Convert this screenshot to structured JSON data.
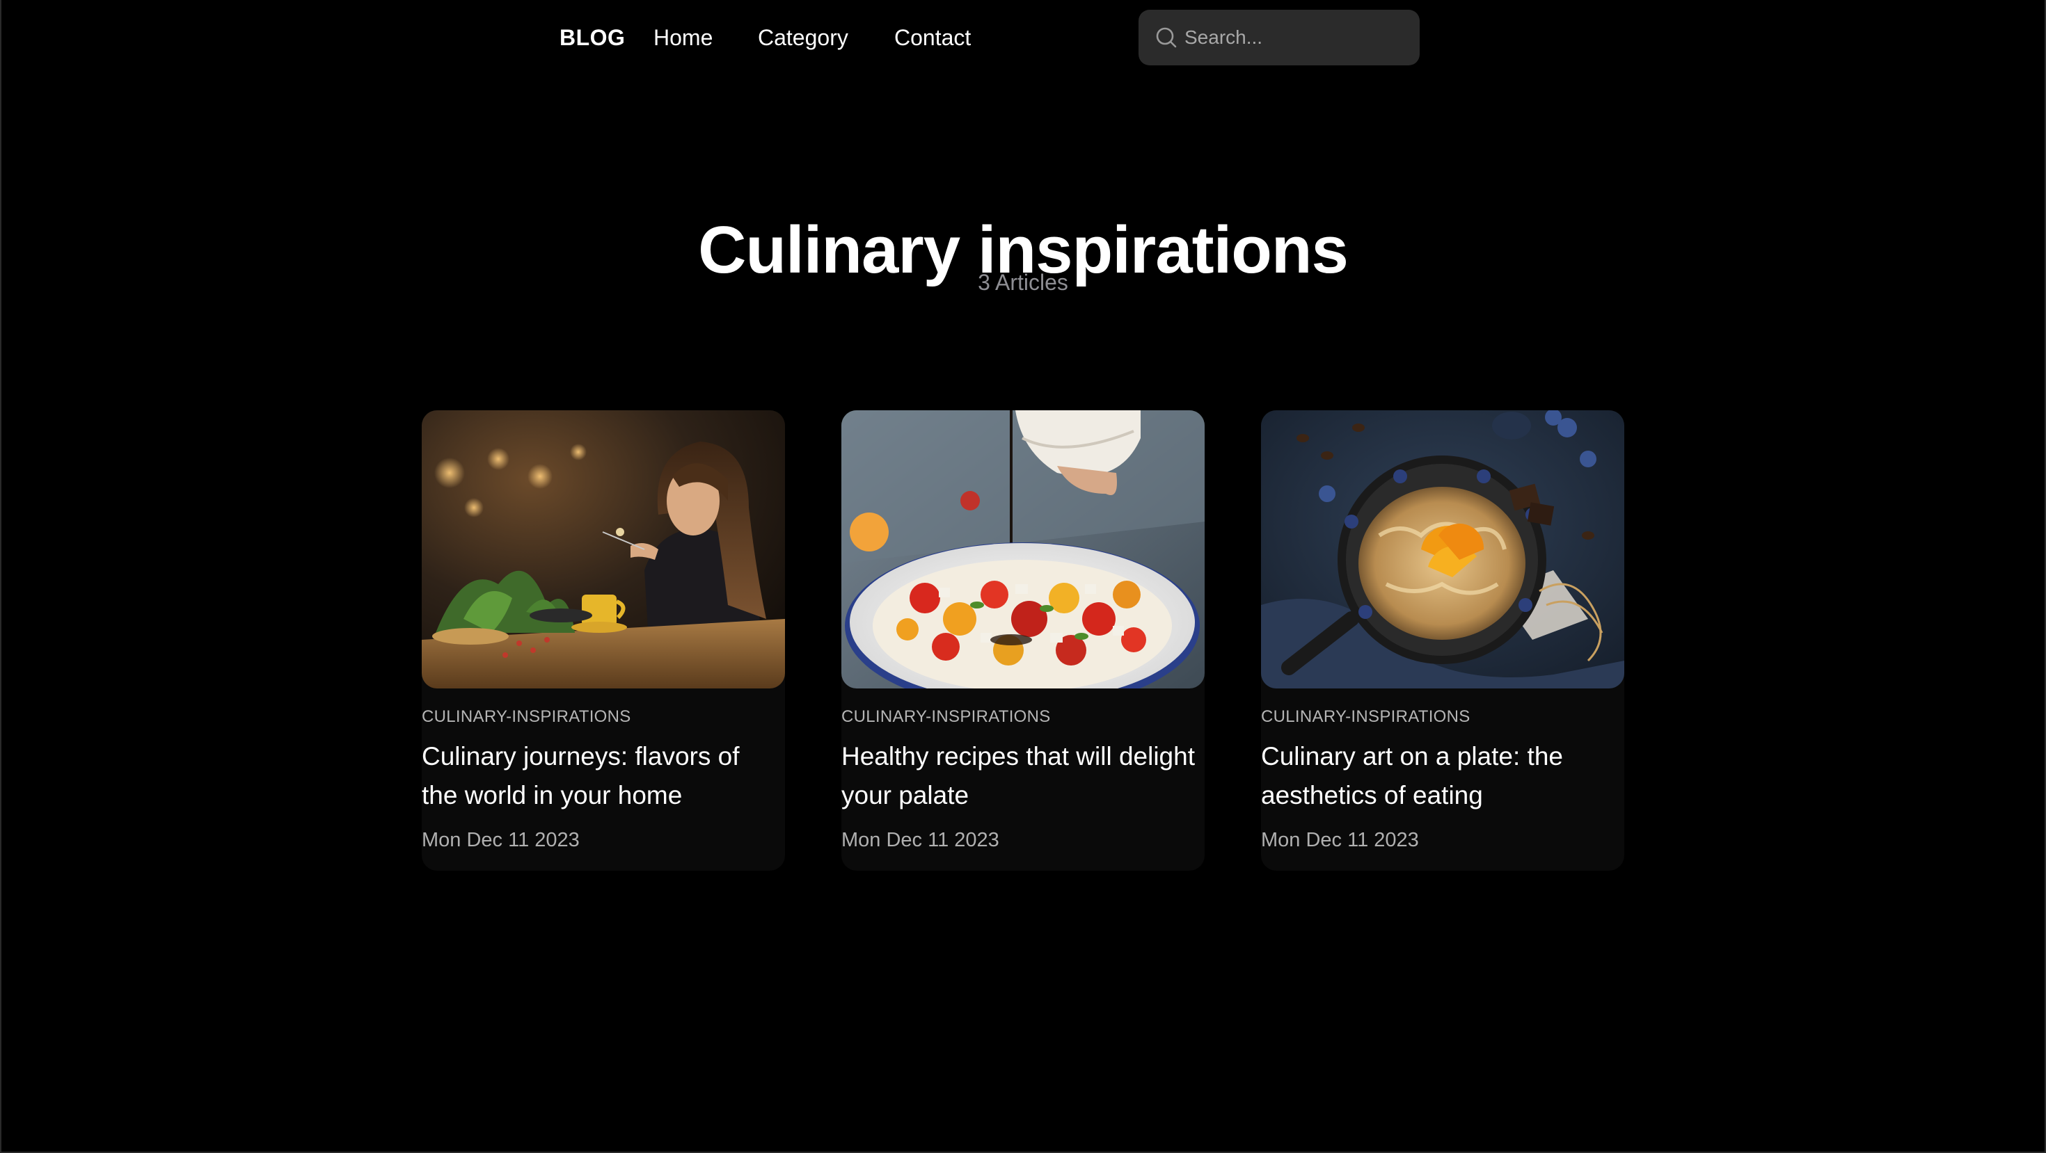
{
  "nav": {
    "brand": "BLOG",
    "links": [
      {
        "label": "Home"
      },
      {
        "label": "Category"
      },
      {
        "label": "Contact"
      }
    ],
    "search": {
      "placeholder": "Search...",
      "icon": "search-icon"
    }
  },
  "hero": {
    "title": "Culinary inspirations",
    "count": "3 Articles"
  },
  "articles": [
    {
      "category": "CULINARY-INSPIRATIONS",
      "title": "Culinary journeys: flavors of the world in your home",
      "date": "Mon Dec 11 2023",
      "image": "woman-eating-in-cafe-photo"
    },
    {
      "category": "CULINARY-INSPIRATIONS",
      "title": "Healthy recipes that will delight your palate",
      "date": "Mon Dec 11 2023",
      "image": "tomato-salad-bowl-photo"
    },
    {
      "category": "CULINARY-INSPIRATIONS",
      "title": "Culinary art on a plate: the aesthetics of eating",
      "date": "Mon Dec 11 2023",
      "image": "pancake-skillet-oranges-photo"
    }
  ],
  "colors": {
    "background": "#000000",
    "search_bg": "#2b2b2b",
    "muted_text": "#8e8e93",
    "text": "#ffffff"
  }
}
